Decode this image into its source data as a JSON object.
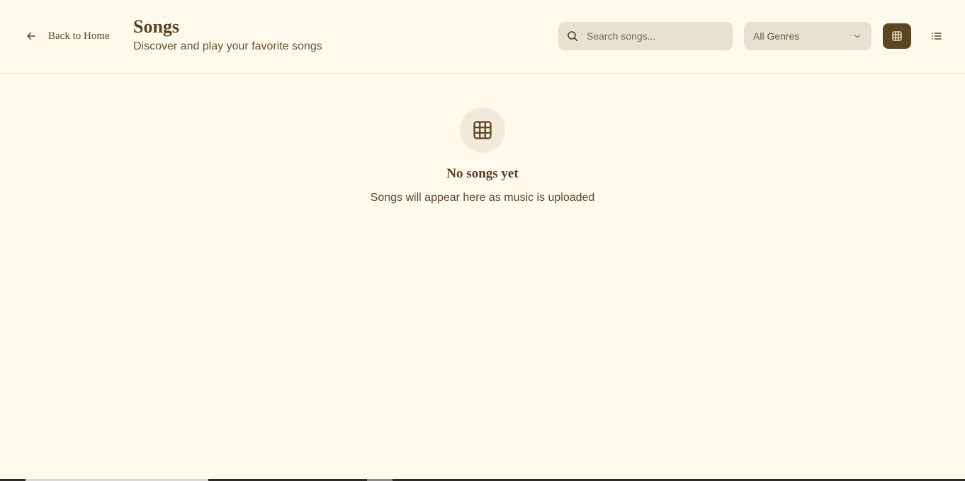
{
  "header": {
    "back_label": "Back to Home",
    "title": "Songs",
    "subtitle": "Discover and play your favorite songs",
    "search": {
      "placeholder": "Search songs...",
      "value": "",
      "icon": "search-icon"
    },
    "genre_filter": {
      "selected": "All Genres",
      "icon": "chevron-down-icon"
    },
    "view_toggle": {
      "active": "grid",
      "grid_icon": "grid-icon",
      "list_icon": "list-icon"
    }
  },
  "empty_state": {
    "icon": "grid-icon",
    "title": "No songs yet",
    "message": "Songs will appear here as music is uploaded"
  },
  "colors": {
    "background": "#fffaeb",
    "accent": "#5c4621",
    "input_bg": "#e7e1d3",
    "text": "#5a4524"
  }
}
